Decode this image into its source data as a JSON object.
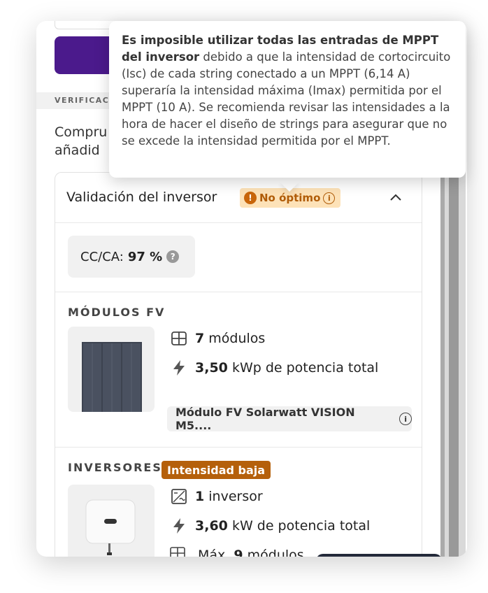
{
  "section_label": "VERIFICACI",
  "description": "Compru\nañadid",
  "tooltip": {
    "bold_text": "Es imposible utilizar todas las entradas de MPPT del inversor",
    "body_text": " debido a que la intensidad de cortocircuito (Isc) de cada string conectado a un MPPT (6,14 A) superaría la intensidad máxima (Imax) permitida por el MPPT (10 A). Se recomienda revisar las intensidades a la hora de hacer el diseño de strings para asegurar que no se excede la intensidad permitida por el MPPT."
  },
  "validation": {
    "title": "Validación del inversor",
    "status_label": "No óptimo",
    "status_color": "#fde2b8"
  },
  "ratio": {
    "label": "CC/CA:",
    "value": "97 %"
  },
  "modules": {
    "section_title": "MÓDULOS FV",
    "count_value": "7",
    "count_unit": "módulos",
    "power_value": "3,50",
    "power_unit": "kWp de potencia total",
    "model_name": "Módulo FV Solarwatt VISION M5...."
  },
  "inverters": {
    "section_title": "INVERSORES",
    "badge_label": "Intensidad baja",
    "badge_color": "#b5600b",
    "count_value": "1",
    "count_unit": "inversor",
    "power_value": "3,60",
    "power_unit": "kW de potencia total",
    "max_prefix": "Máx.",
    "max_value": "9",
    "max_unit": "módulos",
    "max_icon_label": "max"
  }
}
